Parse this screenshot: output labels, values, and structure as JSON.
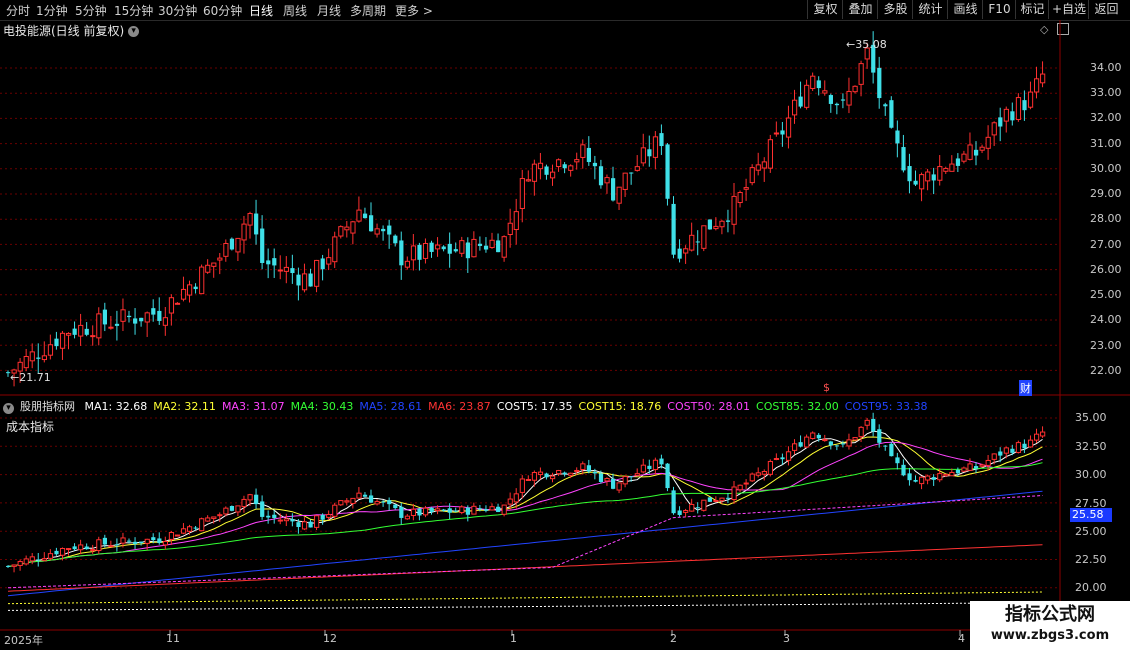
{
  "toolbar": {
    "periods": [
      "分时",
      "1分钟",
      "5分钟",
      "15分钟",
      "30分钟",
      "60分钟",
      "日线",
      "周线",
      "月线",
      "多周期",
      "更多"
    ],
    "active_period": "日线",
    "buttons": [
      "复权",
      "叠加",
      "多股",
      "统计",
      "画线",
      "F10",
      "标记",
      "+自选",
      "返回"
    ]
  },
  "main_chart": {
    "stock_title": "电投能源(日线 前复权)",
    "price_ticks": [
      "34.00",
      "33.00",
      "32.00",
      "31.00",
      "30.00",
      "29.00",
      "28.00",
      "27.00",
      "26.00",
      "25.00",
      "24.00",
      "23.00",
      "22.00"
    ],
    "high_label": "35.08",
    "low_label": "21.71",
    "event_marker": "$",
    "finance_marker": "财"
  },
  "indicator": {
    "site_label": "股朋指标网",
    "name": "成本指标",
    "values": [
      {
        "label": "MA1: 32.68",
        "color": "#ffffff"
      },
      {
        "label": "MA2: 32.11",
        "color": "#ffff33"
      },
      {
        "label": "MA3: 31.07",
        "color": "#ff44ff"
      },
      {
        "label": "MA4: 30.43",
        "color": "#33ff33"
      },
      {
        "label": "MA5: 28.61",
        "color": "#2244ff"
      },
      {
        "label": "MA6: 23.87",
        "color": "#ff3333"
      },
      {
        "label": "COST5: 17.35",
        "color": "#ffffff"
      },
      {
        "label": "COST15: 18.76",
        "color": "#ffff33"
      },
      {
        "label": "COST50: 28.01",
        "color": "#ff44ff"
      },
      {
        "label": "COST85: 32.00",
        "color": "#33ff33"
      },
      {
        "label": "COST95: 33.38",
        "color": "#2244ff"
      }
    ],
    "ticks": [
      "35.00",
      "32.50",
      "30.00",
      "27.50",
      "25.00",
      "22.50",
      "20.00"
    ],
    "current_value": "25.58"
  },
  "time_axis": [
    "2025年",
    "11",
    "12",
    "1",
    "2",
    "3",
    "4"
  ],
  "watermark": {
    "title": "指标公式网",
    "url": "www.zbgs3.com"
  },
  "colors": {
    "up": "#ff3030",
    "down": "#3fe0e8",
    "grid": "#8b0000"
  }
}
